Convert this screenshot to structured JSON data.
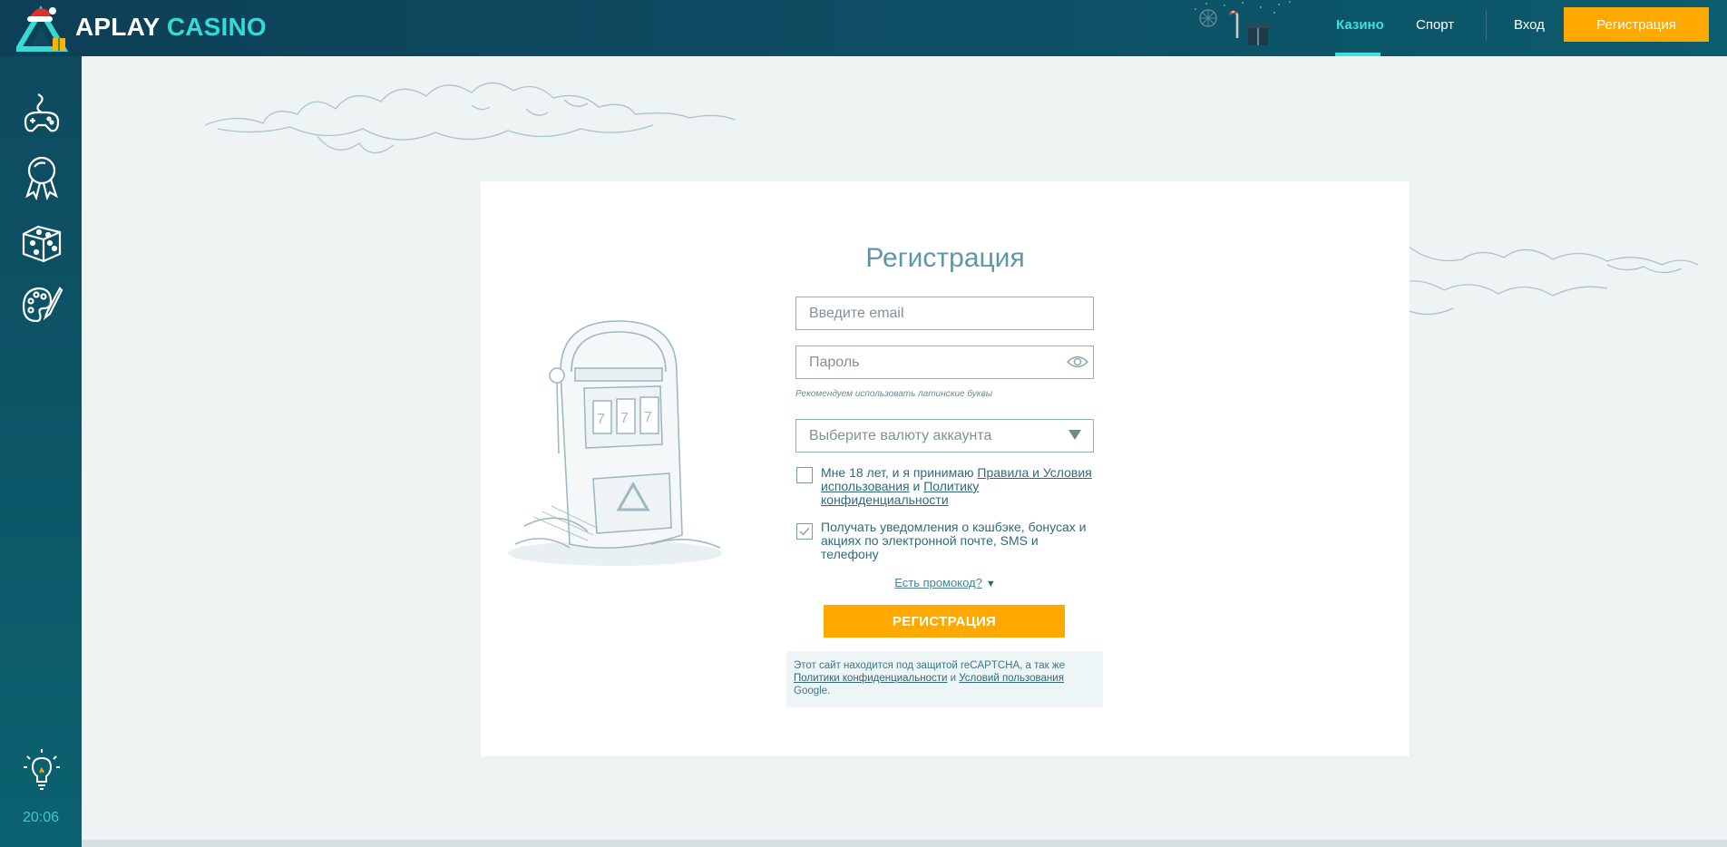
{
  "header": {
    "brand_main": "APLAY",
    "brand_accent": "CASINO",
    "tabs": [
      {
        "label": "Казино",
        "active": true
      },
      {
        "label": "Спорт",
        "active": false
      }
    ],
    "login_label": "Вход",
    "register_label": "Регистрация"
  },
  "sidebar": {
    "icons": [
      "gamepad-icon",
      "award-medal-icon",
      "dice-icon",
      "palette-icon",
      "lightbulb-icon"
    ],
    "time": "20:06"
  },
  "form": {
    "title": "Регистрация",
    "email_placeholder": "Введите email",
    "password_placeholder": "Пароль",
    "password_hint": "Рекомендуем использовать латинские буквы",
    "currency_placeholder": "Выберите валюту аккаунта",
    "terms": {
      "prefix": "Мне 18 лет, и я принимаю ",
      "terms_link": "Правила и Условия использования",
      "middle": " и ",
      "privacy_link": "Политику конфиденциальности",
      "checked": false
    },
    "notifications": {
      "text": "Получать уведомления о кэшбэке, бонусах и акциях по электронной почте, SMS и телефону",
      "checked": true
    },
    "promo_label": "Есть промокод?",
    "promo_arrow": "▼",
    "submit_label": "РЕГИСТРАЦИЯ",
    "recaptcha": {
      "line1": "Этот сайт находится под защитой reCAPTCHA, а так же",
      "privacy_link": "Политики конфиденциальности",
      "middle": " и ",
      "terms_link": "Условий пользования",
      "suffix": "Google."
    }
  },
  "colors": {
    "accent_teal": "#3ee1d9",
    "orange": "#ffa800",
    "header_bg": "#0e4a61",
    "text_teal": "#2d6a7a"
  }
}
